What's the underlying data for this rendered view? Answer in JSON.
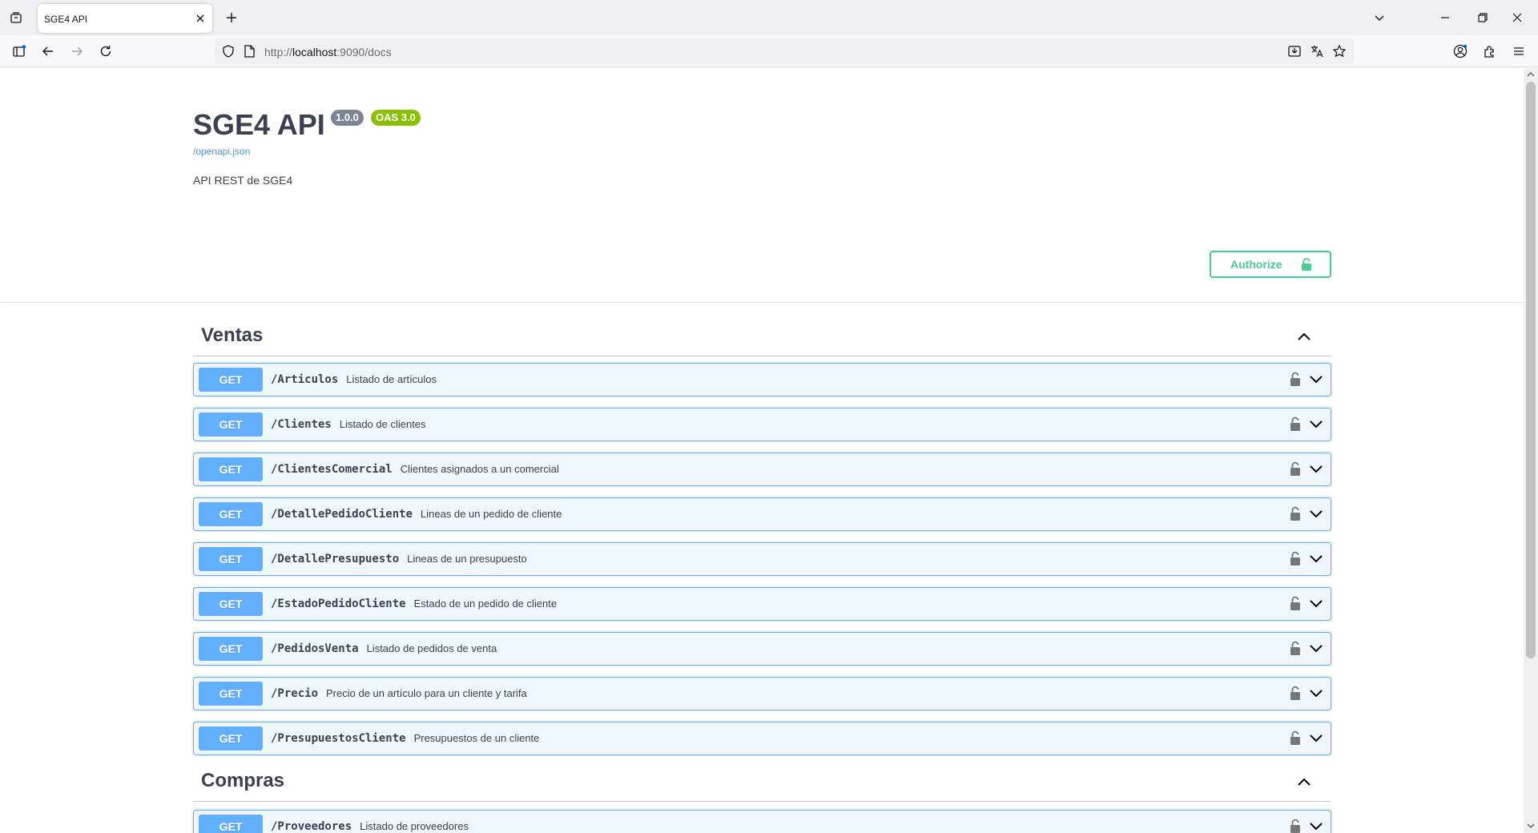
{
  "browser": {
    "tab_title": "SGE4 API",
    "url_prefix": "http://",
    "url_host": "localhost",
    "url_rest": ":9090/docs"
  },
  "info": {
    "title": "SGE4 API",
    "version": "1.0.0",
    "oas": "OAS 3.0",
    "spec_link": "/openapi.json",
    "description": "API REST de SGE4"
  },
  "authorize_label": "Authorize",
  "colors": {
    "get": "#61affe",
    "authorize": "#49cc90",
    "version_badge": "#7d8492",
    "oas_badge": "#89bf04"
  },
  "tags": [
    {
      "name": "Ventas",
      "operations": [
        {
          "method": "GET",
          "path": "/Articulos",
          "summary": "Listado de artículos"
        },
        {
          "method": "GET",
          "path": "/Clientes",
          "summary": "Listado de clientes"
        },
        {
          "method": "GET",
          "path": "/ClientesComercial",
          "summary": "Clientes asignados a un comercial"
        },
        {
          "method": "GET",
          "path": "/DetallePedidoCliente",
          "summary": "Lineas de un pedido de cliente"
        },
        {
          "method": "GET",
          "path": "/DetallePresupuesto",
          "summary": "Lineas de un presupuesto"
        },
        {
          "method": "GET",
          "path": "/EstadoPedidoCliente",
          "summary": "Estado de un pedido de cliente"
        },
        {
          "method": "GET",
          "path": "/PedidosVenta",
          "summary": "Listado de pedidos de venta"
        },
        {
          "method": "GET",
          "path": "/Precio",
          "summary": "Precio de un artículo para un cliente y tarifa"
        },
        {
          "method": "GET",
          "path": "/PresupuestosCliente",
          "summary": "Presupuestos de un cliente"
        }
      ]
    },
    {
      "name": "Compras",
      "operations": [
        {
          "method": "GET",
          "path": "/Proveedores",
          "summary": "Listado de proveedores"
        }
      ]
    }
  ]
}
